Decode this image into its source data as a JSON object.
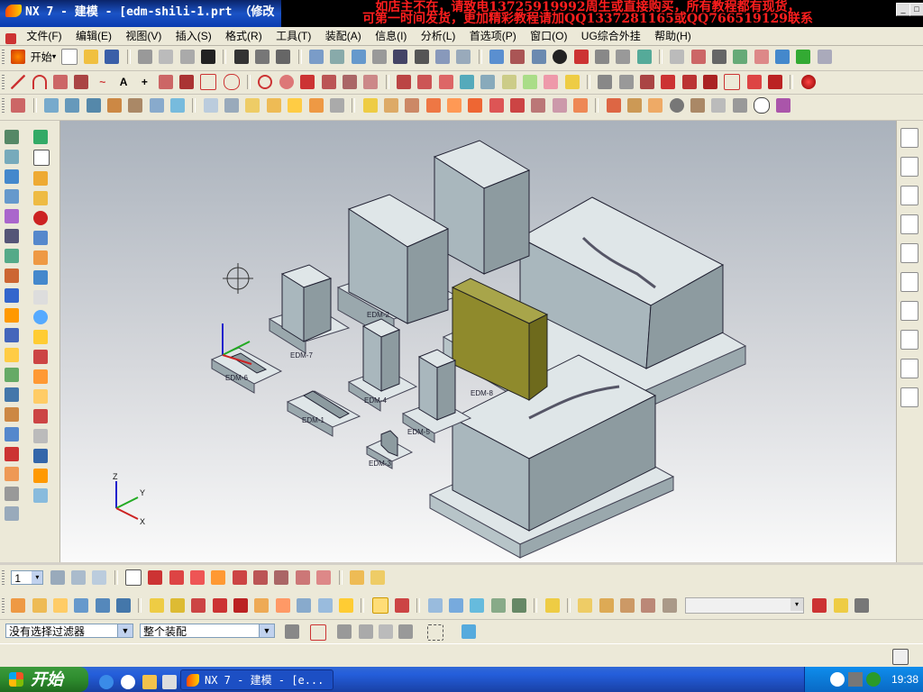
{
  "window": {
    "title": "NX 7 - 建模 - [edm-shili-1.prt （修改",
    "promo_line1": "如店主不在，请致电13725919992周生或直接购买，所有教程都有现货，",
    "promo_line2": "可第一时间发货，更加精彩教程请加QQ1337281165或QQ766519129联系"
  },
  "menu": {
    "items": [
      "文件(F)",
      "编辑(E)",
      "视图(V)",
      "插入(S)",
      "格式(R)",
      "工具(T)",
      "装配(A)",
      "信息(I)",
      "分析(L)",
      "首选项(P)",
      "窗口(O)",
      "UG综合外挂",
      "帮助(H)"
    ]
  },
  "toolbar": {
    "start_label": "开始"
  },
  "viewport": {
    "labels": {
      "b1": "EDM-1",
      "b2": "EDM-2",
      "b3": "EDM-3",
      "b4": "EDM-4",
      "b5": "EDM-5",
      "b6": "EDM-6",
      "b7": "EDM-7",
      "b8": "EDM-8"
    },
    "axis_x": "X",
    "axis_y": "Y",
    "axis_z": "Z"
  },
  "bottom": {
    "layer_value": "1"
  },
  "filter": {
    "selection_filter": "没有选择过滤器",
    "assembly_scope": "整个装配"
  },
  "taskbar": {
    "start": "开始",
    "task_label": "NX 7 - 建模 - [e...",
    "clock": "19:38"
  },
  "colors": {
    "part_body": "#a9b7bd",
    "part_top": "#dfe6e8",
    "selected_body": "#8f8a2c",
    "title_bg": "#0a246a",
    "promo_text": "#ff1e1e"
  }
}
